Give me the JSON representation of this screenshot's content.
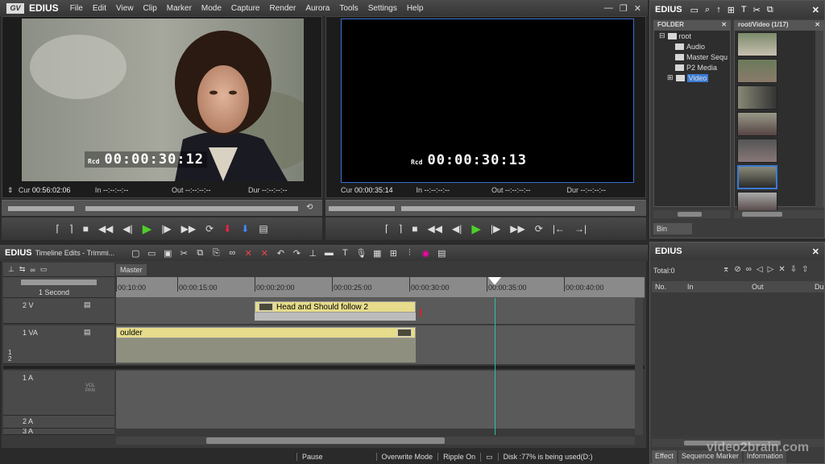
{
  "app": {
    "name": "EDIUS",
    "logo_text": "GV"
  },
  "menu": [
    "File",
    "Edit",
    "View",
    "Clip",
    "Marker",
    "Mode",
    "Capture",
    "Render",
    "Aurora",
    "Tools",
    "Settings",
    "Help"
  ],
  "window_controls": {
    "minimize": "—",
    "restore": "❐",
    "close": "✕"
  },
  "player": {
    "timecode_label": "Rcd",
    "timecode": "00:00:30:12",
    "cur_label": "Cur",
    "cur": "00:56:02:06",
    "in_label": "In",
    "in": "--:--:--:--",
    "out_label": "Out",
    "out": "--:--:--:--",
    "dur_label": "Dur",
    "dur": "--:--:--:--"
  },
  "recorder": {
    "timecode_label": "Rcd",
    "timecode": "00:00:30:13",
    "cur_label": "Cur",
    "cur": "00:00:35:14",
    "in_label": "In",
    "in": "--:--:--:--",
    "out_label": "Out",
    "out": "--:--:--:--",
    "dur_label": "Dur",
    "dur": "--:--:--:--"
  },
  "bin": {
    "title": "EDIUS",
    "folder_header": "FOLDER",
    "path": "root/Video (1/17)",
    "tab": "Bin",
    "tree": [
      {
        "label": "root",
        "level": 0
      },
      {
        "label": "Audio",
        "level": 1
      },
      {
        "label": "Master Sequ",
        "level": 1
      },
      {
        "label": "P2 Media",
        "level": 1
      },
      {
        "label": "Video",
        "level": 1,
        "selected": true
      }
    ]
  },
  "timeline": {
    "brand": "EDIUS",
    "title": "Timeline Edits - Trimmi...",
    "sequence_tab": "Master",
    "scale": "1 Second",
    "ruler": [
      "00:10:00",
      "00:00:15:00",
      "00:00:20:00",
      "00:00:25:00",
      "00:00:30:00",
      "00:00:35:00",
      "00:00:40:00"
    ],
    "tracks": {
      "v2": "2 V",
      "va1": "1 VA",
      "a1": "1 A",
      "a2": "2 A",
      "a3": "3 A"
    },
    "va1_sub": "1\n2",
    "vol_label": "VOL\nPAN",
    "clips": {
      "v2_clip": "Head and Should follow 2",
      "va1_clip": "oulder"
    }
  },
  "marker_panel": {
    "title": "EDIUS",
    "total": "Total:0",
    "columns": [
      "No.",
      "In",
      "Out",
      "Du"
    ],
    "tabs": [
      "Effect",
      "Sequence Marker",
      "Information"
    ]
  },
  "status": {
    "pause": "Pause",
    "mode": "Overwrite Mode",
    "ripple": "Ripple On",
    "disk": "Disk :77% is being used(D:)"
  },
  "watermark": "video2brain.com",
  "colors": {
    "accent_green": "#4fce2a",
    "clip_yellow": "#e6dc8b",
    "selection_blue": "#3a7bd5"
  }
}
